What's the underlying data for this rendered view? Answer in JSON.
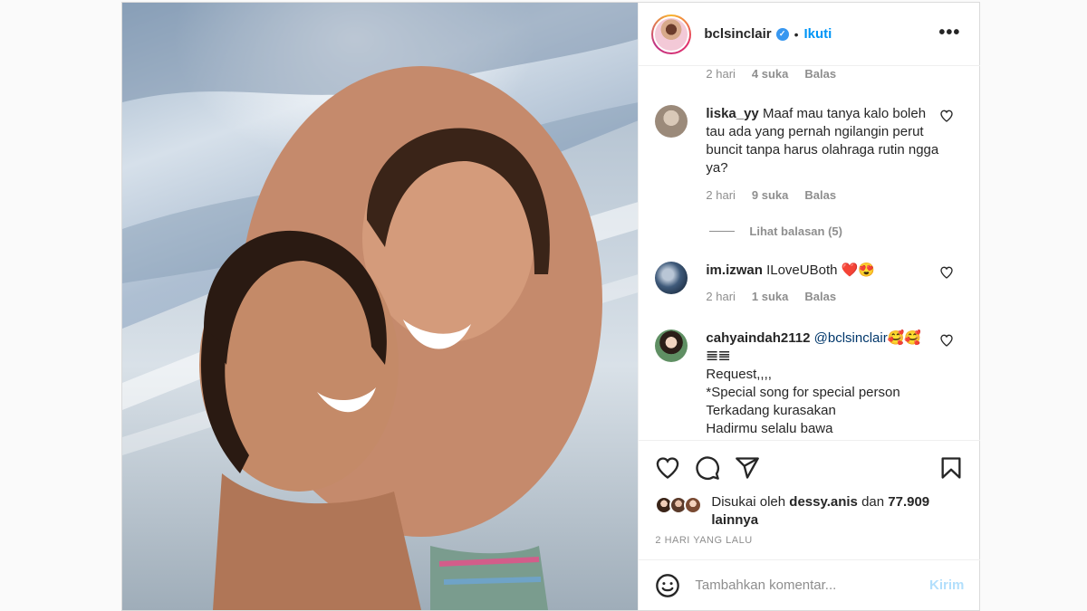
{
  "post": {
    "author": "bclsinclair",
    "verified_icon": "verified-badge-icon",
    "follow_label": "Ikuti",
    "more_icon": "more-options-icon",
    "photo_description_icon": "beach-selfie-photo"
  },
  "comments": {
    "top_meta": {
      "time": "2 hari",
      "likes": "4 suka",
      "reply": "Balas"
    },
    "items": [
      {
        "username": "liska_yy",
        "text": "Maaf mau tanya kalo boleh tau ada yang pernah ngilangin perut buncit tanpa harus olahraga rutin ngga ya?",
        "time": "2 hari",
        "likes": "9 suka",
        "reply": "Balas",
        "view_replies": "Lihat balasan (5)"
      },
      {
        "username": "im.izwan",
        "text": "ILoveUBoth ❤️😍",
        "time": "2 hari",
        "likes": "1 suka",
        "reply": "Balas"
      },
      {
        "username": "cahyaindah2112",
        "mention": "@bclsinclair",
        "mention_suffix": "🥰🥰",
        "line2": "𝌆𝌆",
        "line3": "Request,,,,",
        "line4": "*Special song for special person",
        "line5": "Terkadang kurasakan",
        "line6": "Hadirmu selalu bawa"
      }
    ]
  },
  "actions": {
    "like_icon": "heart-icon",
    "comment_icon": "comment-icon",
    "share_icon": "send-icon",
    "save_icon": "bookmark-icon",
    "liked_prefix": "Disukai oleh",
    "liked_user": "dessy.anis",
    "liked_and": "dan",
    "liked_count": "77.909",
    "liked_suffix": "lainnya",
    "timestamp": "2 HARI YANG LALU"
  },
  "add_comment": {
    "placeholder": "Tambahkan komentar...",
    "send_label": "Kirim",
    "emoji_icon": "emoji-icon"
  },
  "colors": {
    "accent": "#0095f6",
    "send_disabled": "#b2dffc",
    "muted": "#8e8e8e",
    "text": "#262626",
    "verified": "#3897f0"
  }
}
